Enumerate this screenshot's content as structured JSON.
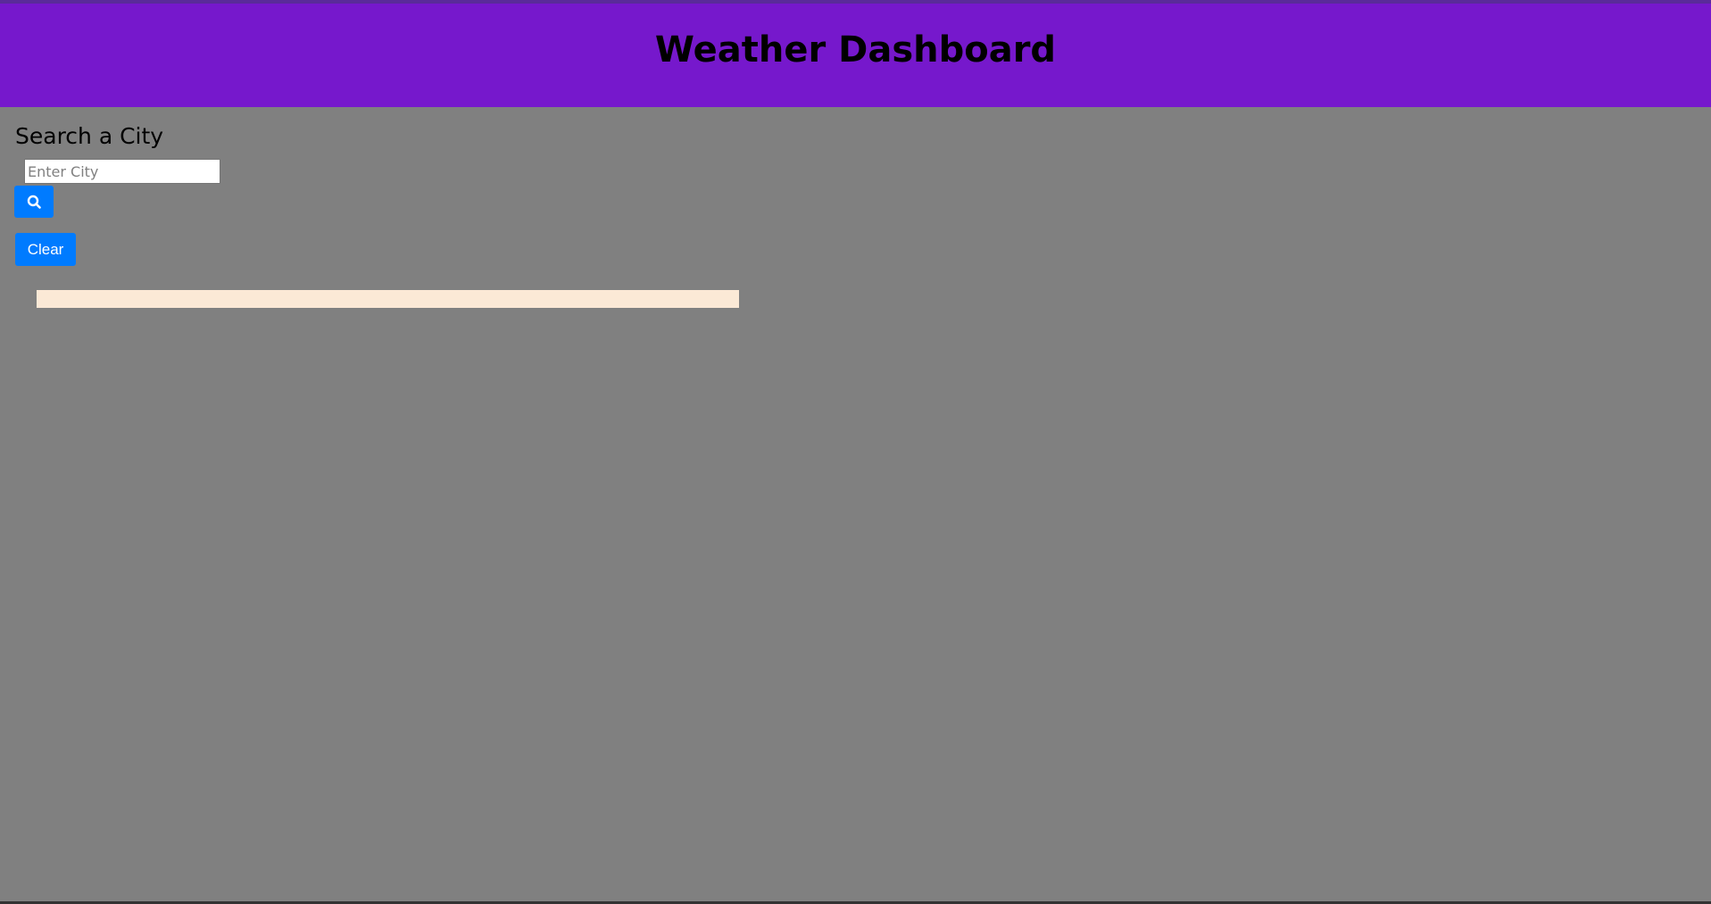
{
  "header": {
    "title": "Weather Dashboard"
  },
  "search": {
    "heading": "Search a City",
    "placeholder": "Enter City",
    "value": "",
    "search_icon": "search-icon",
    "clear_label": "Clear"
  },
  "history": {
    "items": []
  },
  "colors": {
    "header_bg": "#7618cc",
    "page_bg": "#808080",
    "button_bg": "#007bff",
    "history_bg": "#fbe9d6"
  }
}
